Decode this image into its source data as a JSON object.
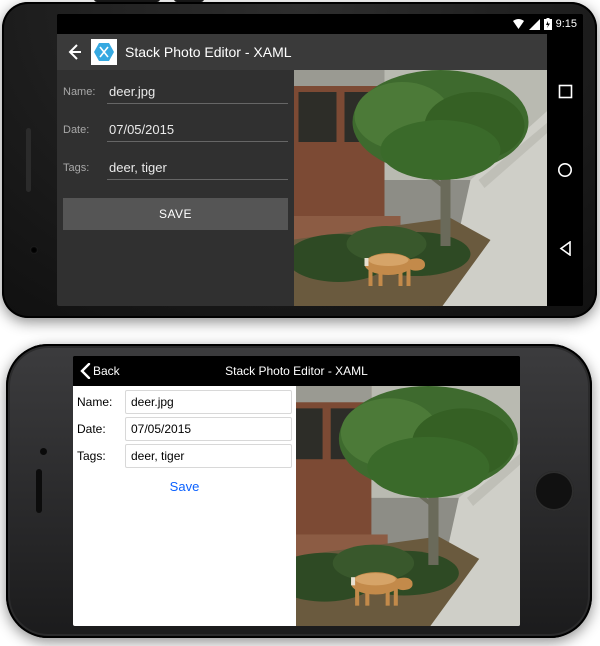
{
  "android": {
    "status": {
      "time": "9:15"
    },
    "appbar": {
      "title": "Stack Photo Editor - XAML"
    },
    "form": {
      "name_label": "Name:",
      "name_value": "deer.jpg",
      "date_label": "Date:",
      "date_value": "07/05/2015",
      "tags_label": "Tags:",
      "tags_value": "deer, tiger",
      "save_label": "SAVE"
    }
  },
  "iphone": {
    "nav": {
      "back_label": "Back",
      "title": "Stack Photo Editor - XAML"
    },
    "form": {
      "name_label": "Name:",
      "name_value": "deer.jpg",
      "date_label": "Date:",
      "date_value": "07/05/2015",
      "tags_label": "Tags:",
      "tags_value": "deer, tiger",
      "save_label": "Save"
    }
  }
}
